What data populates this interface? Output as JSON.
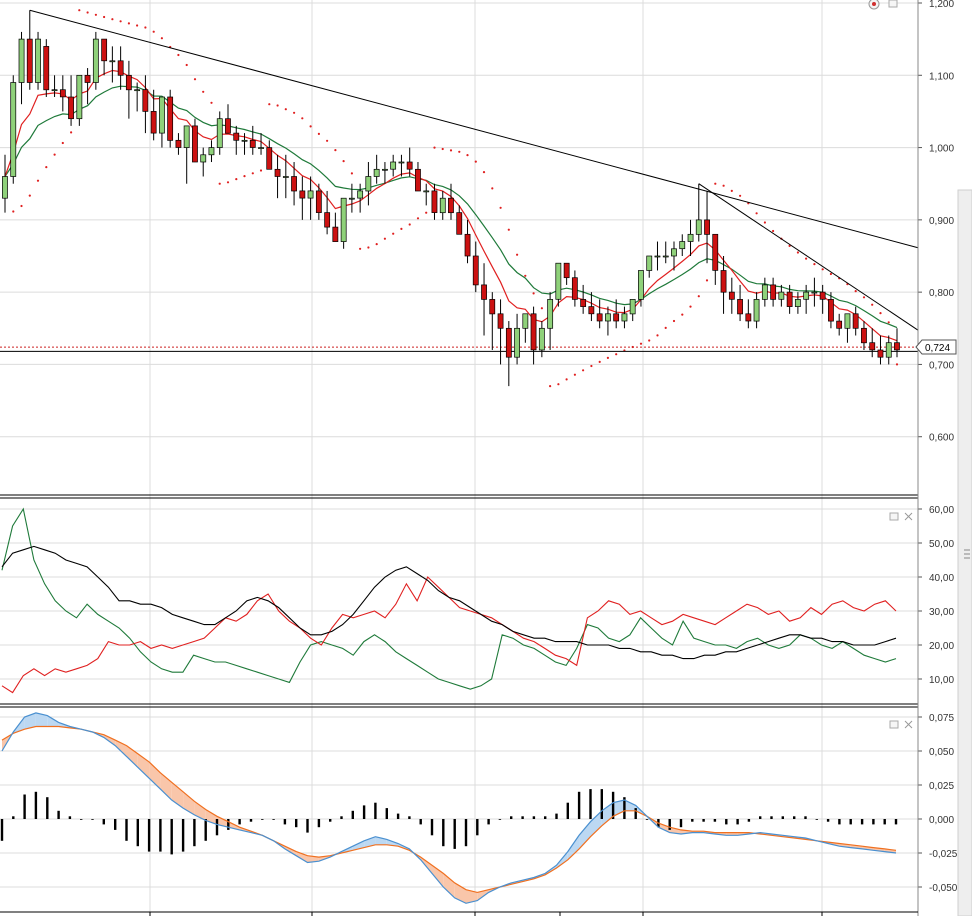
{
  "chart_data": [
    {
      "type": "candlestick",
      "panel": "price",
      "ylim": [
        0.5,
        1.2
      ],
      "y_ticks": [
        "0,600",
        "0,700",
        "0,800",
        "0,900",
        "1,000",
        "1,100",
        "1,200"
      ],
      "current_value": 0.724,
      "current_label": "0,724",
      "horizontal_line_value": 0.718,
      "grid": true,
      "colors": {
        "up": "#8fd17a",
        "down": "#cc1111",
        "ema_fast": "#e02020",
        "ema_slow": "#1f7a3a",
        "sar": "#e02020",
        "trendline": "#000000"
      },
      "candles": [
        [
          0.93,
          0.99,
          0.91,
          0.96
        ],
        [
          0.96,
          1.1,
          0.95,
          1.09
        ],
        [
          1.09,
          1.16,
          1.06,
          1.15
        ],
        [
          1.15,
          1.19,
          1.08,
          1.09
        ],
        [
          1.09,
          1.16,
          1.08,
          1.15
        ],
        [
          1.14,
          1.15,
          1.07,
          1.08
        ],
        [
          1.08,
          1.1,
          1.07,
          1.08
        ],
        [
          1.08,
          1.1,
          1.05,
          1.07
        ],
        [
          1.07,
          1.1,
          1.03,
          1.04
        ],
        [
          1.04,
          1.1,
          1.03,
          1.1
        ],
        [
          1.1,
          1.11,
          1.06,
          1.09
        ],
        [
          1.09,
          1.16,
          1.08,
          1.15
        ],
        [
          1.15,
          1.15,
          1.1,
          1.12
        ],
        [
          1.12,
          1.14,
          1.09,
          1.12
        ],
        [
          1.12,
          1.14,
          1.08,
          1.1
        ],
        [
          1.1,
          1.12,
          1.04,
          1.08
        ],
        [
          1.08,
          1.09,
          1.05,
          1.08
        ],
        [
          1.08,
          1.1,
          1.02,
          1.05
        ],
        [
          1.05,
          1.08,
          1.01,
          1.02
        ],
        [
          1.02,
          1.07,
          1.0,
          1.07
        ],
        [
          1.07,
          1.08,
          1.0,
          1.01
        ],
        [
          1.01,
          1.02,
          0.99,
          1.0
        ],
        [
          1.0,
          1.03,
          0.95,
          1.03
        ],
        [
          1.03,
          1.04,
          0.98,
          0.98
        ],
        [
          0.98,
          1.0,
          0.96,
          0.99
        ],
        [
          0.99,
          1.01,
          0.98,
          1.0
        ],
        [
          1.0,
          1.05,
          0.99,
          1.04
        ],
        [
          1.04,
          1.06,
          1.02,
          1.02
        ],
        [
          1.02,
          1.03,
          0.99,
          1.01
        ],
        [
          1.01,
          1.02,
          0.99,
          1.01
        ],
        [
          1.01,
          1.03,
          0.99,
          1.0
        ],
        [
          1.0,
          1.02,
          0.99,
          1.0
        ],
        [
          1.0,
          1.01,
          0.97,
          0.97
        ],
        [
          0.97,
          0.99,
          0.93,
          0.96
        ],
        [
          0.96,
          0.99,
          0.93,
          0.96
        ],
        [
          0.96,
          0.98,
          0.92,
          0.94
        ],
        [
          0.94,
          0.96,
          0.9,
          0.93
        ],
        [
          0.93,
          0.96,
          0.9,
          0.94
        ],
        [
          0.94,
          0.95,
          0.9,
          0.91
        ],
        [
          0.91,
          0.94,
          0.88,
          0.89
        ],
        [
          0.89,
          0.91,
          0.87,
          0.87
        ],
        [
          0.87,
          0.93,
          0.86,
          0.93
        ],
        [
          0.93,
          0.95,
          0.91,
          0.93
        ],
        [
          0.93,
          0.95,
          0.91,
          0.94
        ],
        [
          0.94,
          0.98,
          0.92,
          0.96
        ],
        [
          0.96,
          0.99,
          0.95,
          0.97
        ],
        [
          0.97,
          0.98,
          0.95,
          0.97
        ],
        [
          0.97,
          0.99,
          0.96,
          0.98
        ],
        [
          0.98,
          0.99,
          0.96,
          0.98
        ],
        [
          0.98,
          1.0,
          0.96,
          0.97
        ],
        [
          0.97,
          0.98,
          0.94,
          0.94
        ],
        [
          0.94,
          0.95,
          0.92,
          0.94
        ],
        [
          0.94,
          0.95,
          0.9,
          0.91
        ],
        [
          0.91,
          0.94,
          0.9,
          0.93
        ],
        [
          0.93,
          0.95,
          0.9,
          0.91
        ],
        [
          0.91,
          0.92,
          0.88,
          0.88
        ],
        [
          0.88,
          0.9,
          0.84,
          0.85
        ],
        [
          0.85,
          0.87,
          0.8,
          0.81
        ],
        [
          0.81,
          0.84,
          0.74,
          0.79
        ],
        [
          0.79,
          0.8,
          0.72,
          0.77
        ],
        [
          0.77,
          0.79,
          0.7,
          0.75
        ],
        [
          0.75,
          0.76,
          0.67,
          0.71
        ],
        [
          0.71,
          0.77,
          0.7,
          0.75
        ],
        [
          0.75,
          0.77,
          0.73,
          0.77
        ],
        [
          0.77,
          0.78,
          0.7,
          0.72
        ],
        [
          0.72,
          0.76,
          0.71,
          0.75
        ],
        [
          0.75,
          0.8,
          0.72,
          0.79
        ],
        [
          0.79,
          0.84,
          0.78,
          0.84
        ],
        [
          0.84,
          0.84,
          0.81,
          0.82
        ],
        [
          0.82,
          0.83,
          0.78,
          0.79
        ],
        [
          0.79,
          0.81,
          0.77,
          0.78
        ],
        [
          0.78,
          0.8,
          0.76,
          0.77
        ],
        [
          0.77,
          0.79,
          0.75,
          0.76
        ],
        [
          0.76,
          0.78,
          0.74,
          0.77
        ],
        [
          0.77,
          0.79,
          0.75,
          0.76
        ],
        [
          0.76,
          0.78,
          0.75,
          0.77
        ],
        [
          0.77,
          0.79,
          0.76,
          0.79
        ],
        [
          0.79,
          0.83,
          0.78,
          0.83
        ],
        [
          0.83,
          0.85,
          0.82,
          0.85
        ],
        [
          0.85,
          0.87,
          0.83,
          0.85
        ],
        [
          0.85,
          0.87,
          0.84,
          0.85
        ],
        [
          0.85,
          0.87,
          0.83,
          0.86
        ],
        [
          0.86,
          0.88,
          0.85,
          0.87
        ],
        [
          0.87,
          0.9,
          0.85,
          0.88
        ],
        [
          0.88,
          0.95,
          0.87,
          0.9
        ],
        [
          0.9,
          0.94,
          0.84,
          0.88
        ],
        [
          0.88,
          0.88,
          0.81,
          0.83
        ],
        [
          0.83,
          0.85,
          0.77,
          0.8
        ],
        [
          0.8,
          0.82,
          0.77,
          0.79
        ],
        [
          0.79,
          0.81,
          0.76,
          0.77
        ],
        [
          0.77,
          0.79,
          0.75,
          0.76
        ],
        [
          0.76,
          0.8,
          0.75,
          0.79
        ],
        [
          0.79,
          0.82,
          0.78,
          0.81
        ],
        [
          0.81,
          0.82,
          0.78,
          0.79
        ],
        [
          0.79,
          0.81,
          0.78,
          0.8
        ],
        [
          0.8,
          0.81,
          0.77,
          0.78
        ],
        [
          0.78,
          0.8,
          0.77,
          0.79
        ],
        [
          0.79,
          0.81,
          0.77,
          0.8
        ],
        [
          0.8,
          0.82,
          0.78,
          0.8
        ],
        [
          0.8,
          0.81,
          0.77,
          0.79
        ],
        [
          0.79,
          0.8,
          0.75,
          0.76
        ],
        [
          0.76,
          0.77,
          0.74,
          0.75
        ],
        [
          0.75,
          0.77,
          0.73,
          0.77
        ],
        [
          0.77,
          0.78,
          0.74,
          0.75
        ],
        [
          0.75,
          0.76,
          0.72,
          0.73
        ],
        [
          0.73,
          0.75,
          0.71,
          0.72
        ],
        [
          0.72,
          0.74,
          0.7,
          0.71
        ],
        [
          0.71,
          0.74,
          0.7,
          0.73
        ],
        [
          0.73,
          0.75,
          0.71,
          0.72
        ]
      ]
    },
    {
      "type": "line",
      "panel": "dmi",
      "ylim": [
        5,
        62
      ],
      "y_ticks": [
        "10,00",
        "20,00",
        "30,00",
        "40,00",
        "50,00",
        "60,00"
      ],
      "grid": true,
      "series": [
        {
          "color": "#1f7a3a",
          "values": [
            42,
            55,
            60,
            45,
            38,
            33,
            30,
            28,
            32,
            29,
            27,
            25,
            22,
            18,
            15,
            13,
            12,
            12,
            17,
            16,
            15,
            15,
            14,
            13,
            12,
            11,
            10,
            9,
            15,
            20,
            21,
            20,
            19,
            17,
            21,
            23,
            21,
            18,
            16,
            14,
            12,
            10,
            9,
            8,
            7,
            8,
            10,
            23,
            22,
            20,
            19,
            17,
            15,
            14,
            19,
            26,
            25,
            22,
            21,
            23,
            28,
            25,
            22,
            20,
            27,
            22,
            21,
            20,
            20,
            19,
            21,
            22,
            20,
            19,
            20,
            23,
            22,
            20,
            19,
            21,
            19,
            17,
            16,
            15,
            16
          ]
        },
        {
          "color": "#e02020",
          "values": [
            8,
            6,
            11,
            13,
            11,
            13,
            12,
            13,
            14,
            16,
            21,
            20,
            20,
            21,
            19,
            20,
            19,
            20,
            21,
            22,
            25,
            28,
            27,
            29,
            33,
            35,
            30,
            27,
            25,
            22,
            20,
            25,
            29,
            28,
            29,
            30,
            28,
            32,
            38,
            33,
            40,
            37,
            34,
            31,
            30,
            29,
            28,
            26,
            24,
            22,
            21,
            19,
            17,
            16,
            14,
            28,
            30,
            33,
            32,
            29,
            30,
            28,
            26,
            27,
            29,
            28,
            27,
            26,
            28,
            30,
            32,
            31,
            29,
            30,
            27,
            28,
            31,
            29,
            32,
            33,
            31,
            30,
            32,
            33,
            30
          ]
        },
        {
          "color": "#000000",
          "values": [
            43,
            47,
            48,
            49,
            48,
            47,
            45,
            44,
            43,
            40,
            37,
            33,
            33,
            32,
            32,
            31,
            29,
            28,
            27,
            26,
            26,
            28,
            30,
            33,
            34,
            33,
            31,
            28,
            25,
            23,
            23,
            24,
            26,
            29,
            33,
            37,
            40,
            42,
            43,
            41,
            39,
            36,
            34,
            33,
            31,
            29,
            27,
            26,
            24,
            23,
            22,
            22,
            21,
            21,
            21,
            20,
            20,
            20,
            19,
            19,
            18,
            18,
            17,
            17,
            16,
            16,
            17,
            17,
            18,
            18,
            19,
            20,
            21,
            22,
            23,
            23,
            22,
            22,
            21,
            21,
            20,
            20,
            20,
            21,
            22
          ]
        }
      ]
    },
    {
      "type": "line",
      "panel": "macd",
      "ylim": [
        -0.06,
        0.08
      ],
      "y_ticks": [
        "-0,050",
        "-0,025",
        "0,000",
        "0,025",
        "0,050",
        "0,075"
      ],
      "grid": true,
      "colors": {
        "signal": "#f07020",
        "macd": "#4a90d0",
        "histogram": "#000000",
        "fill_above": "#bcd8f2",
        "fill_below": "#f9c6aa"
      },
      "macd_values": [
        0.05,
        0.064,
        0.075,
        0.078,
        0.076,
        0.071,
        0.068,
        0.066,
        0.064,
        0.06,
        0.054,
        0.046,
        0.038,
        0.03,
        0.022,
        0.014,
        0.008,
        0.003,
        -0.001,
        -0.004,
        -0.006,
        -0.008,
        -0.01,
        -0.012,
        -0.016,
        -0.022,
        -0.027,
        -0.032,
        -0.031,
        -0.028,
        -0.024,
        -0.02,
        -0.016,
        -0.013,
        -0.015,
        -0.018,
        -0.022,
        -0.03,
        -0.04,
        -0.05,
        -0.058,
        -0.062,
        -0.06,
        -0.054,
        -0.05,
        -0.047,
        -0.045,
        -0.043,
        -0.04,
        -0.034,
        -0.024,
        -0.012,
        -0.002,
        0.006,
        0.012,
        0.014,
        0.01,
        0.002,
        -0.006,
        -0.01,
        -0.011,
        -0.01,
        -0.01,
        -0.011,
        -0.012,
        -0.012,
        -0.011,
        -0.01,
        -0.011,
        -0.012,
        -0.013,
        -0.014,
        -0.016,
        -0.018,
        -0.02,
        -0.021,
        -0.022,
        -0.023,
        -0.024,
        -0.025
      ],
      "signal_values": [
        0.058,
        0.063,
        0.066,
        0.068,
        0.068,
        0.068,
        0.067,
        0.066,
        0.064,
        0.062,
        0.058,
        0.054,
        0.048,
        0.042,
        0.034,
        0.027,
        0.02,
        0.013,
        0.007,
        0.002,
        -0.002,
        -0.006,
        -0.009,
        -0.012,
        -0.016,
        -0.02,
        -0.024,
        -0.027,
        -0.028,
        -0.027,
        -0.025,
        -0.023,
        -0.021,
        -0.019,
        -0.019,
        -0.02,
        -0.023,
        -0.028,
        -0.034,
        -0.04,
        -0.047,
        -0.052,
        -0.054,
        -0.052,
        -0.05,
        -0.048,
        -0.046,
        -0.044,
        -0.041,
        -0.036,
        -0.03,
        -0.022,
        -0.013,
        -0.005,
        0.002,
        0.006,
        0.006,
        0.002,
        -0.003,
        -0.006,
        -0.008,
        -0.009,
        -0.009,
        -0.01,
        -0.01,
        -0.01,
        -0.01,
        -0.011,
        -0.012,
        -0.013,
        -0.014,
        -0.015,
        -0.016,
        -0.017,
        -0.018,
        -0.019,
        -0.02,
        -0.021,
        -0.022,
        -0.023
      ]
    }
  ]
}
